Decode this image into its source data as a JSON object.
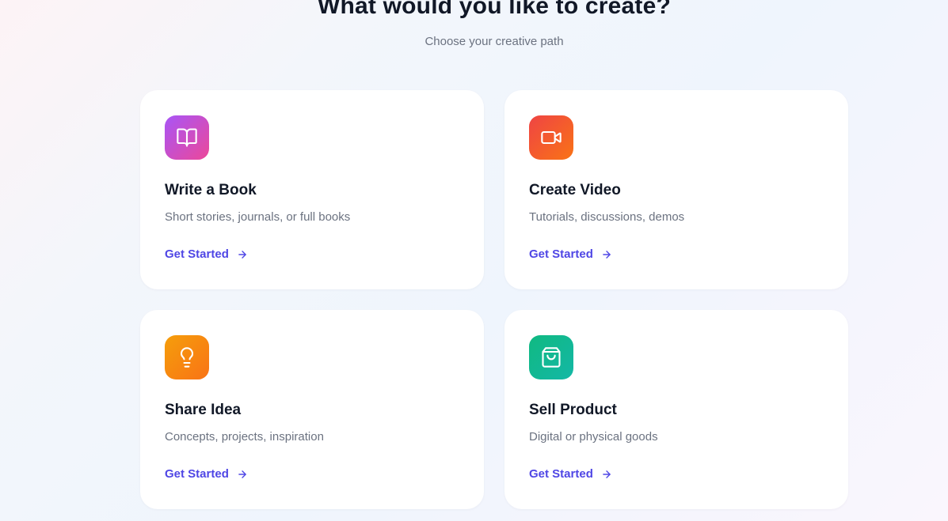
{
  "header": {
    "title": "What would you like to create?",
    "subtitle": "Choose your creative path"
  },
  "cards": [
    {
      "title": "Write a Book",
      "description": "Short stories, journals, or full books",
      "cta": "Get Started",
      "icon": "book-open-icon",
      "gradient": [
        "#a855f7",
        "#ec4899"
      ]
    },
    {
      "title": "Create Video",
      "description": "Tutorials, discussions, demos",
      "cta": "Get Started",
      "icon": "video-camera-icon",
      "gradient": [
        "#ef4444",
        "#f97316"
      ]
    },
    {
      "title": "Share Idea",
      "description": "Concepts, projects, inspiration",
      "cta": "Get Started",
      "icon": "lightbulb-icon",
      "gradient": [
        "#f59e0b",
        "#f97316"
      ]
    },
    {
      "title": "Sell Product",
      "description": "Digital or physical goods",
      "cta": "Get Started",
      "icon": "shopping-bag-icon",
      "gradient": [
        "#10b981",
        "#14b8a6"
      ]
    }
  ],
  "colors": {
    "accent": "#4f46e5",
    "title": "#111827",
    "muted": "#6b7280"
  }
}
